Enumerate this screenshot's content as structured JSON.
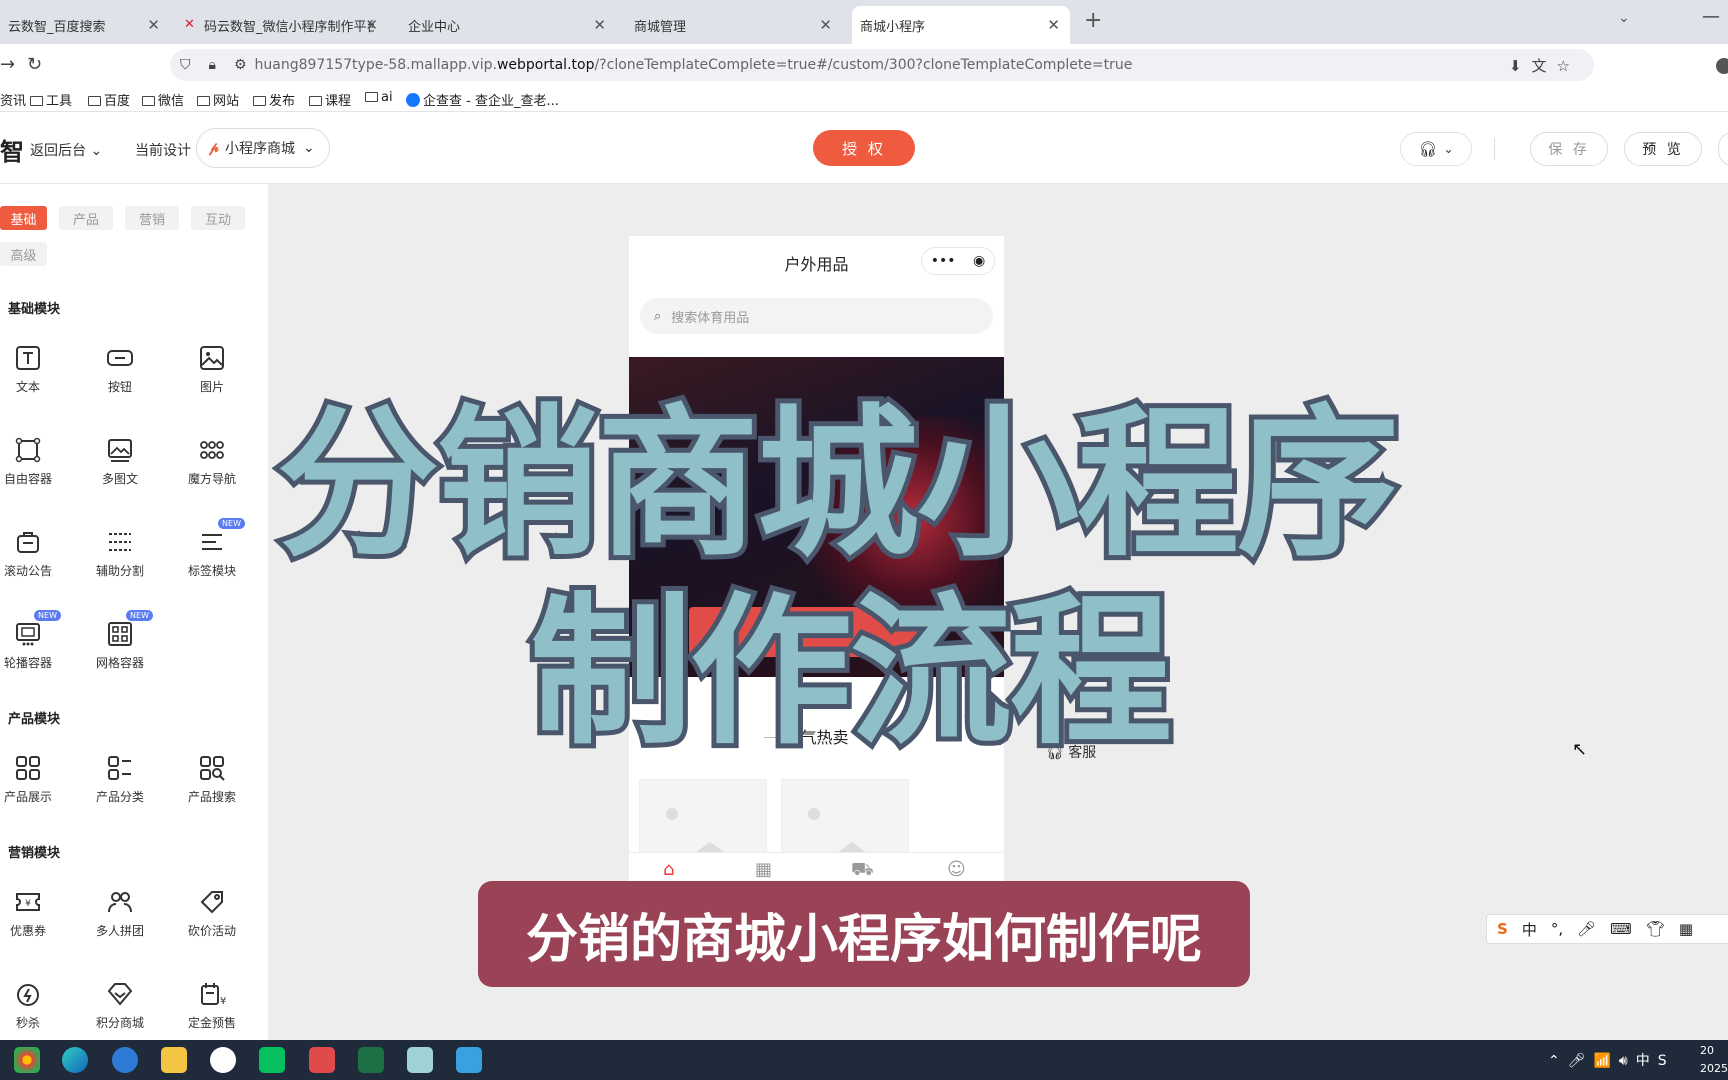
{
  "browser": {
    "tabs": [
      {
        "label": "云数智_百度搜索"
      },
      {
        "label": "码云数智_微信小程序制作平台_"
      },
      {
        "label": "企业中心"
      },
      {
        "label": "商城管理"
      },
      {
        "label": "商城小程序"
      }
    ],
    "url_prefix": "huang897157type-58.mallapp.vip.",
    "url_host": "webportal.top",
    "url_rest": "/?cloneTemplateComplete=true#/custom/300?cloneTemplateComplete=true",
    "bookmarks": [
      "资讯",
      "工具",
      "百度",
      "微信",
      "网站",
      "发布",
      "课程",
      "ai",
      "企查查 - 查企业_查老..."
    ]
  },
  "header": {
    "logo": "智",
    "back": "返回后台",
    "current_design_label": "当前设计",
    "design_name": "小程序商城",
    "auth_button": "授 权",
    "save_button": "保 存",
    "preview_button": "预 览"
  },
  "sidebar": {
    "categories": [
      "基础",
      "产品",
      "营销",
      "互动",
      "高级"
    ],
    "sections": {
      "basic": "基础模块",
      "product": "产品模块",
      "marketing": "营销模块"
    },
    "basic_items": [
      "文本",
      "按钮",
      "图片",
      "自由容器",
      "多图文",
      "魔方导航",
      "滚动公告",
      "辅助分割",
      "标签模块",
      "轮播容器",
      "网格容器"
    ],
    "product_items": [
      "产品展示",
      "产品分类",
      "产品搜索"
    ],
    "marketing_items": [
      "优惠券",
      "多人拼团",
      "砍价活动",
      "秒杀",
      "积分商城",
      "定金预售"
    ],
    "new_badge": "NEW"
  },
  "phone": {
    "title": "户外用品",
    "search_placeholder": "搜索体育用品",
    "hot_section": "人气热卖"
  },
  "side_panel": {
    "service": "客服"
  },
  "overlay": {
    "line1": "分销商城小程序",
    "line2": "制作流程",
    "subtitle": "分销的商城小程序如何制作呢"
  },
  "ime": {
    "mode": "中"
  },
  "taskbar": {
    "ime": "中",
    "clock_line1": "20",
    "clock_line2": "2025"
  },
  "colors": {
    "accent": "#ef5b3f",
    "overlay_fill": "#8fc0c8",
    "overlay_stroke": "#4a566b",
    "subtitle_bg": "#9a4256"
  }
}
